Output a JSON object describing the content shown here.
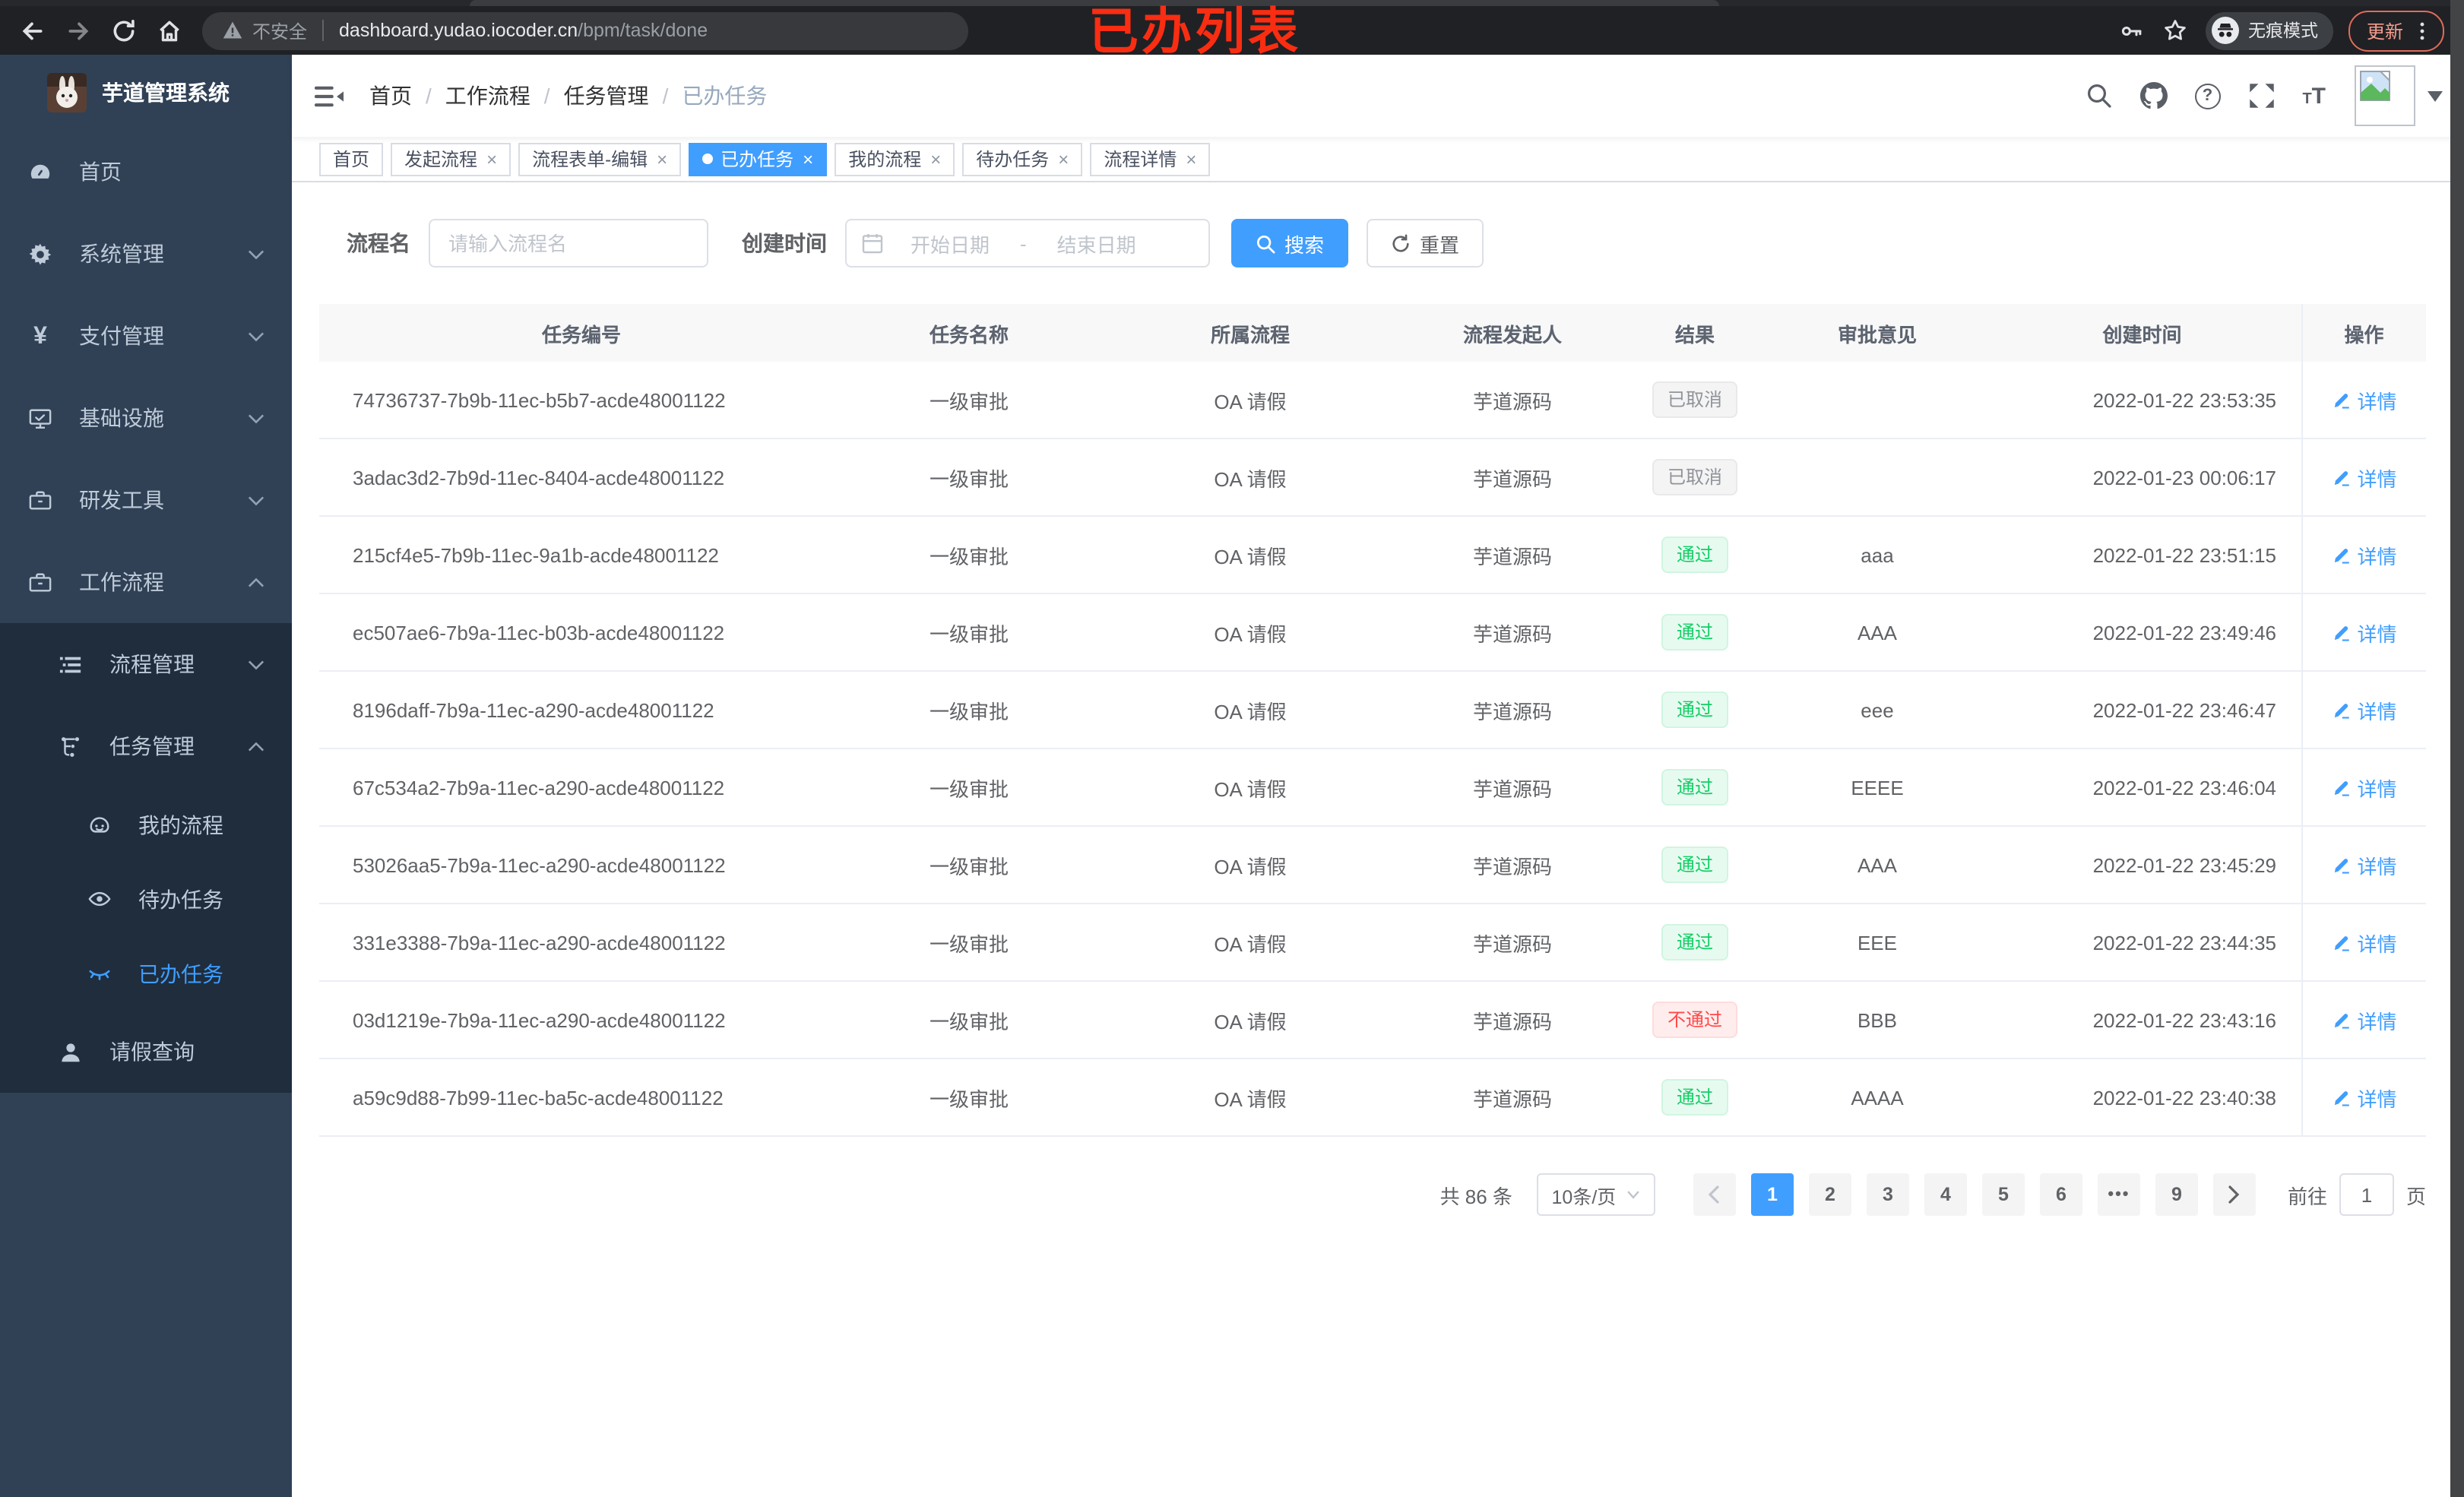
{
  "browser": {
    "security_label": "不安全",
    "url_domain": "dashboard.yudao.iocoder.cn",
    "url_path": "/bpm/task/done",
    "incognito_label": "无痕模式",
    "update_label": "更新",
    "annotation": "已办列表"
  },
  "sidebar": {
    "app_title": "芋道管理系统",
    "items": [
      {
        "label": "首页"
      },
      {
        "label": "系统管理"
      },
      {
        "label": "支付管理"
      },
      {
        "label": "基础设施"
      },
      {
        "label": "研发工具"
      },
      {
        "label": "工作流程"
      },
      {
        "label": "流程管理"
      },
      {
        "label": "任务管理"
      },
      {
        "label": "我的流程"
      },
      {
        "label": "待办任务"
      },
      {
        "label": "已办任务"
      },
      {
        "label": "请假查询"
      }
    ]
  },
  "breadcrumb": {
    "items": [
      "首页",
      "工作流程",
      "任务管理",
      "已办任务"
    ]
  },
  "tabs": {
    "items": [
      {
        "label": "首页",
        "closable": false,
        "active": false
      },
      {
        "label": "发起流程",
        "closable": true,
        "active": false
      },
      {
        "label": "流程表单-编辑",
        "closable": true,
        "active": false
      },
      {
        "label": "已办任务",
        "closable": true,
        "active": true
      },
      {
        "label": "我的流程",
        "closable": true,
        "active": false
      },
      {
        "label": "待办任务",
        "closable": true,
        "active": false
      },
      {
        "label": "流程详情",
        "closable": true,
        "active": false
      }
    ]
  },
  "filters": {
    "name_label": "流程名",
    "name_placeholder": "请输入流程名",
    "time_label": "创建时间",
    "start_placeholder": "开始日期",
    "range_separator": "-",
    "end_placeholder": "结束日期",
    "search_label": "搜索",
    "reset_label": "重置"
  },
  "table": {
    "columns": [
      "任务编号",
      "任务名称",
      "所属流程",
      "流程发起人",
      "结果",
      "审批意见",
      "创建时间",
      "操作"
    ],
    "action_label": "详情",
    "rows": [
      {
        "id": "74736737-7b9b-11ec-b5b7-acde48001122",
        "name": "一级审批",
        "process": "OA 请假",
        "initiator": "芋道源码",
        "result": "已取消",
        "result_type": "info",
        "comment": "",
        "created": "2022-01-22 23:53:35"
      },
      {
        "id": "3adac3d2-7b9d-11ec-8404-acde48001122",
        "name": "一级审批",
        "process": "OA 请假",
        "initiator": "芋道源码",
        "result": "已取消",
        "result_type": "info",
        "comment": "",
        "created": "2022-01-23 00:06:17"
      },
      {
        "id": "215cf4e5-7b9b-11ec-9a1b-acde48001122",
        "name": "一级审批",
        "process": "OA 请假",
        "initiator": "芋道源码",
        "result": "通过",
        "result_type": "success",
        "comment": "aaa",
        "created": "2022-01-22 23:51:15"
      },
      {
        "id": "ec507ae6-7b9a-11ec-b03b-acde48001122",
        "name": "一级审批",
        "process": "OA 请假",
        "initiator": "芋道源码",
        "result": "通过",
        "result_type": "success",
        "comment": "AAA",
        "created": "2022-01-22 23:49:46"
      },
      {
        "id": "8196daff-7b9a-11ec-a290-acde48001122",
        "name": "一级审批",
        "process": "OA 请假",
        "initiator": "芋道源码",
        "result": "通过",
        "result_type": "success",
        "comment": "eee",
        "created": "2022-01-22 23:46:47"
      },
      {
        "id": "67c534a2-7b9a-11ec-a290-acde48001122",
        "name": "一级审批",
        "process": "OA 请假",
        "initiator": "芋道源码",
        "result": "通过",
        "result_type": "success",
        "comment": "EEEE",
        "created": "2022-01-22 23:46:04"
      },
      {
        "id": "53026aa5-7b9a-11ec-a290-acde48001122",
        "name": "一级审批",
        "process": "OA 请假",
        "initiator": "芋道源码",
        "result": "通过",
        "result_type": "success",
        "comment": "AAA",
        "created": "2022-01-22 23:45:29"
      },
      {
        "id": "331e3388-7b9a-11ec-a290-acde48001122",
        "name": "一级审批",
        "process": "OA 请假",
        "initiator": "芋道源码",
        "result": "通过",
        "result_type": "success",
        "comment": "EEE",
        "created": "2022-01-22 23:44:35"
      },
      {
        "id": "03d1219e-7b9a-11ec-a290-acde48001122",
        "name": "一级审批",
        "process": "OA 请假",
        "initiator": "芋道源码",
        "result": "不通过",
        "result_type": "danger",
        "comment": "BBB",
        "created": "2022-01-22 23:43:16"
      },
      {
        "id": "a59c9d88-7b99-11ec-ba5c-acde48001122",
        "name": "一级审批",
        "process": "OA 请假",
        "initiator": "芋道源码",
        "result": "通过",
        "result_type": "success",
        "comment": "AAAA",
        "created": "2022-01-22 23:40:38"
      }
    ]
  },
  "pagination": {
    "total_label": "共 86 条",
    "page_size_label": "10条/页",
    "pages": [
      "1",
      "2",
      "3",
      "4",
      "5",
      "6",
      "•••",
      "9"
    ],
    "active_page": "1",
    "goto_label": "前往",
    "goto_value": "1",
    "page_unit": "页"
  },
  "colors": {
    "accent": "#409eff",
    "success": "#13ce66",
    "danger": "#ff4949",
    "info": "#909399",
    "sidebar": "#304156",
    "submenu": "#1f2d3d"
  }
}
